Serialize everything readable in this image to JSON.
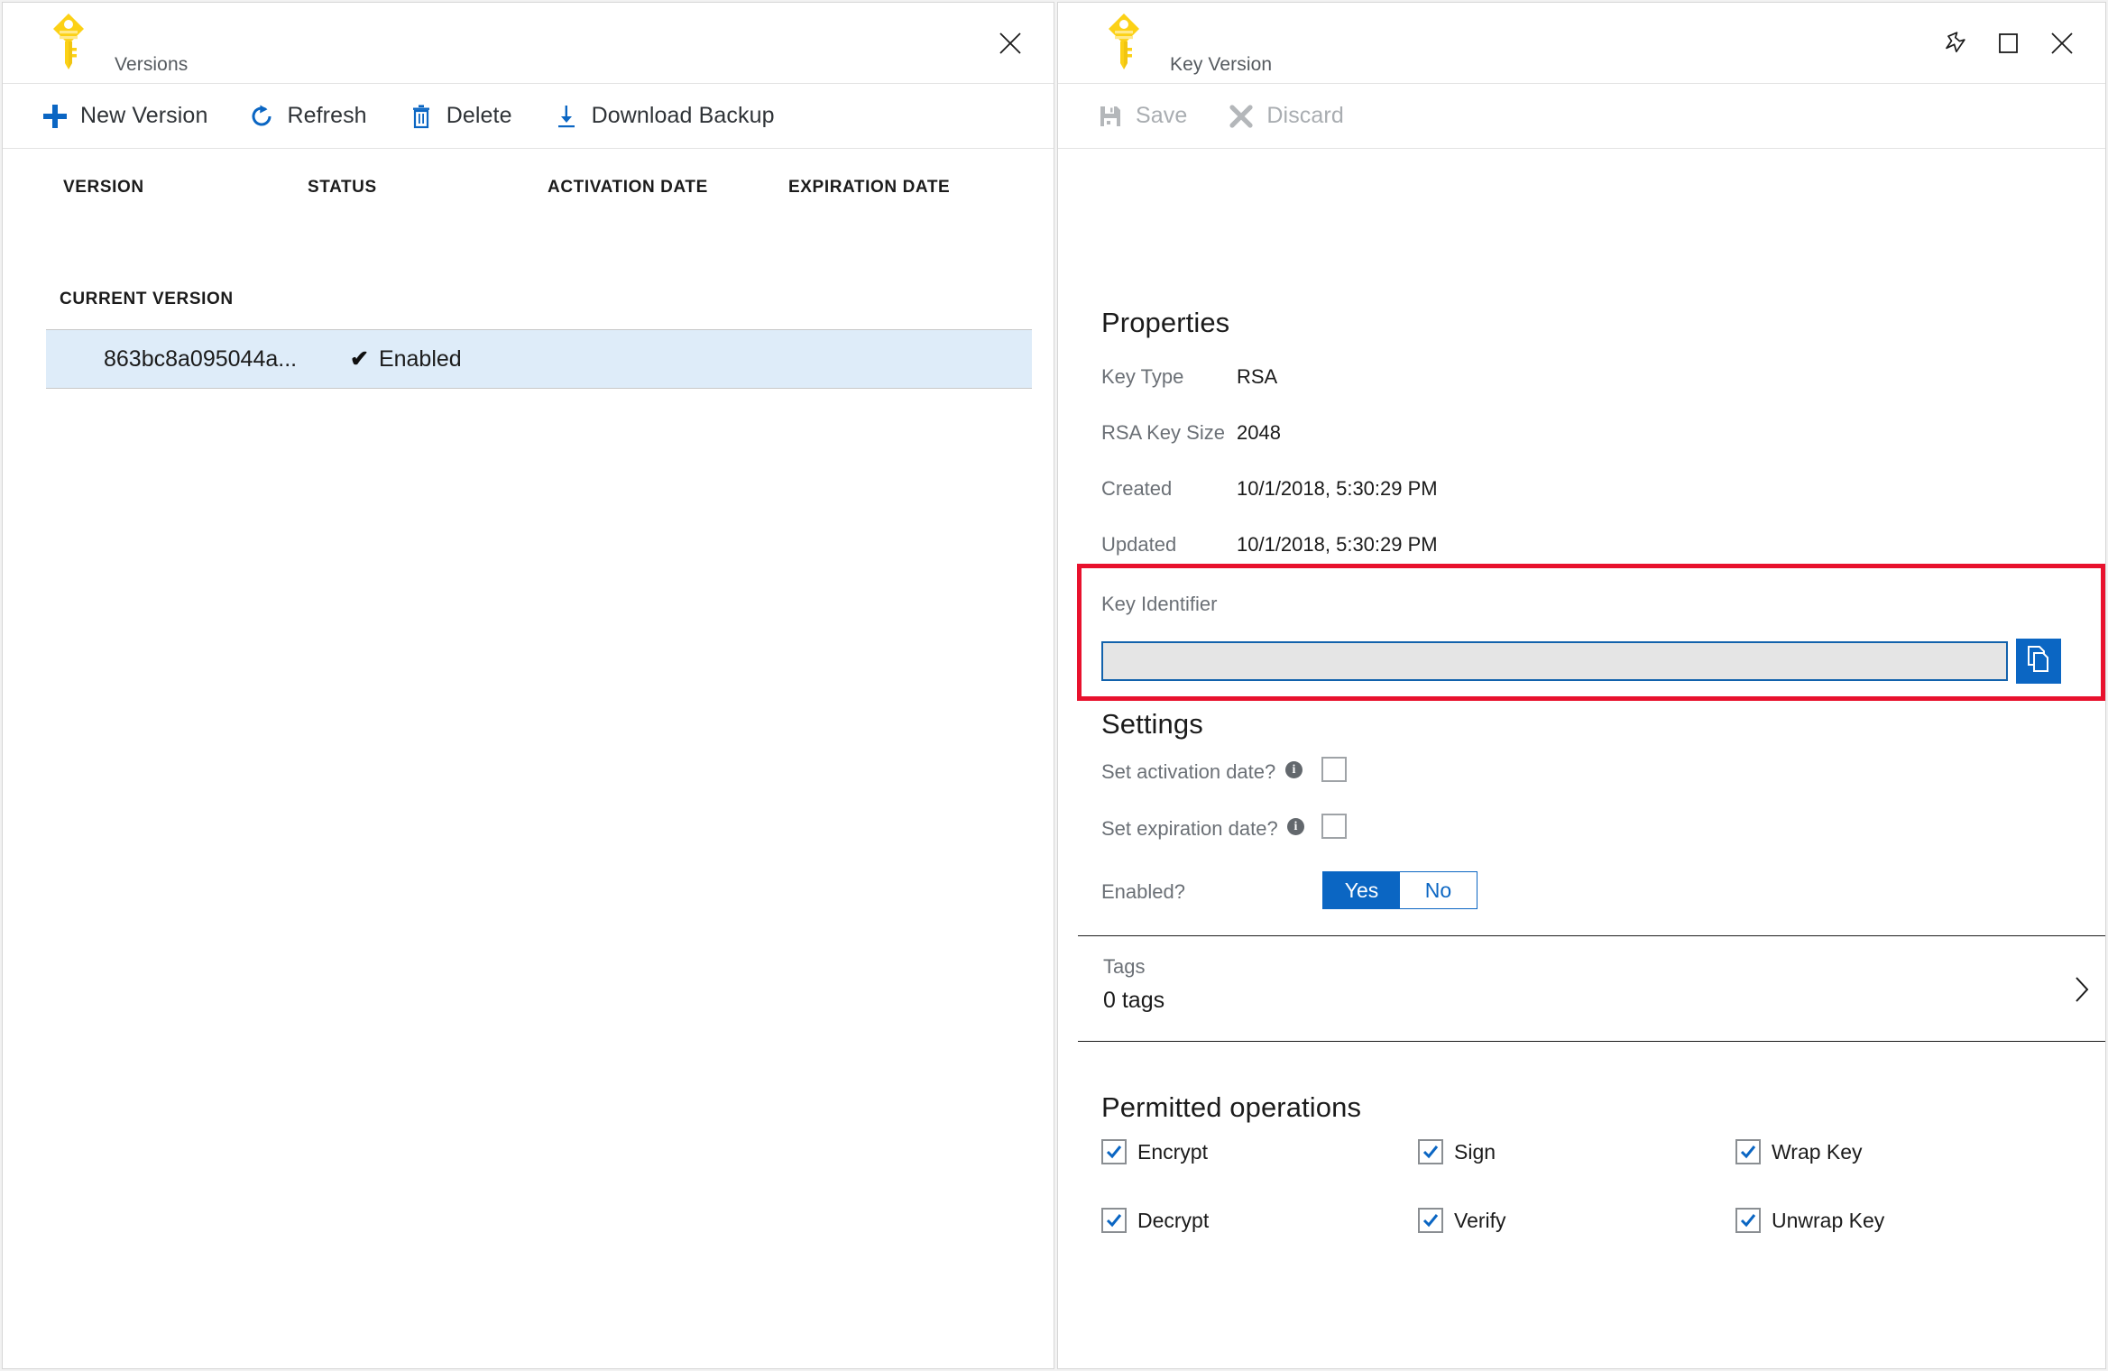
{
  "left_panel": {
    "icon": "key-icon",
    "title": "Versions",
    "close_icon": "close-icon",
    "toolbar": [
      {
        "id": "new-version",
        "label": "New Version",
        "icon": "plus-icon"
      },
      {
        "id": "refresh",
        "label": "Refresh",
        "icon": "refresh-icon"
      },
      {
        "id": "delete",
        "label": "Delete",
        "icon": "trash-icon"
      },
      {
        "id": "download-backup",
        "label": "Download Backup",
        "icon": "download-icon"
      }
    ],
    "table": {
      "columns": [
        "VERSION",
        "STATUS",
        "ACTIVATION DATE",
        "EXPIRATION DATE"
      ],
      "group_label": "CURRENT VERSION",
      "rows": [
        {
          "version": "863bc8a095044a...",
          "status": "Enabled",
          "status_icon": "checkmark-icon",
          "activation_date": "",
          "expiration_date": "",
          "selected": true
        }
      ]
    }
  },
  "right_panel": {
    "icon": "key-icon",
    "title": "Key Version",
    "window_buttons": [
      {
        "id": "pin",
        "icon": "pin-icon"
      },
      {
        "id": "maximize",
        "icon": "maximize-icon"
      },
      {
        "id": "close",
        "icon": "close-icon"
      }
    ],
    "toolbar": [
      {
        "id": "save",
        "label": "Save",
        "icon": "save-icon",
        "disabled": true
      },
      {
        "id": "discard",
        "label": "Discard",
        "icon": "discard-icon",
        "disabled": true
      }
    ],
    "properties": {
      "heading": "Properties",
      "items": [
        {
          "label": "Key Type",
          "value": "RSA"
        },
        {
          "label": "RSA Key Size",
          "value": "2048"
        },
        {
          "label": "Created",
          "value": "10/1/2018, 5:30:29 PM"
        },
        {
          "label": "Updated",
          "value": "10/1/2018, 5:30:29 PM"
        }
      ]
    },
    "key_identifier": {
      "label": "Key Identifier",
      "value": "",
      "placeholder": "",
      "copy_icon": "copy-icon",
      "highlight_color": "#e8112d"
    },
    "settings": {
      "heading": "Settings",
      "activation": {
        "label": "Set activation date?",
        "info_icon": "info-icon",
        "checked": false
      },
      "expiration": {
        "label": "Set expiration date?",
        "info_icon": "info-icon",
        "checked": false
      },
      "enabled": {
        "label": "Enabled?",
        "yes_label": "Yes",
        "no_label": "No",
        "selected": "Yes"
      }
    },
    "tags": {
      "label": "Tags",
      "value": "0 tags",
      "chevron_icon": "chevron-right-icon"
    },
    "permitted_operations": {
      "heading": "Permitted operations",
      "items": [
        {
          "label": "Encrypt",
          "checked": true
        },
        {
          "label": "Sign",
          "checked": true
        },
        {
          "label": "Wrap Key",
          "checked": true
        },
        {
          "label": "Decrypt",
          "checked": true
        },
        {
          "label": "Verify",
          "checked": true
        },
        {
          "label": "Unwrap Key",
          "checked": true
        }
      ]
    }
  },
  "colors": {
    "accent_blue": "#0b66c3",
    "selected_row": "#deecf9",
    "key_yellow": "#fdd835",
    "highlight_red": "#e8112d"
  }
}
